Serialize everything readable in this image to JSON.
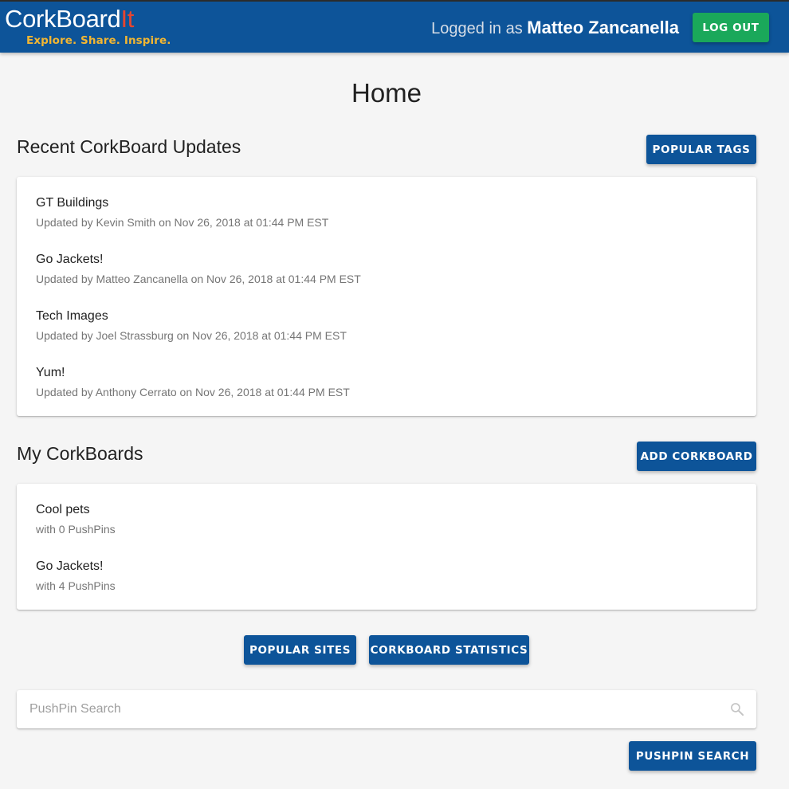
{
  "header": {
    "logo_main": "CorkBoard",
    "logo_accent": "It",
    "tagline": "Explore. Share. Inspire.",
    "login_prefix": "Logged in as",
    "user_name": "Matteo Zancanella",
    "logout_label": "LOG OUT"
  },
  "page_title": "Home",
  "recent": {
    "heading": "Recent CorkBoard Updates",
    "button_label": "POPULAR TAGS",
    "items": [
      {
        "title": "GT Buildings",
        "subtitle": "Updated by Kevin Smith on Nov 26, 2018 at 01:44 PM EST"
      },
      {
        "title": "Go Jackets!",
        "subtitle": "Updated by Matteo Zancanella on Nov 26, 2018 at 01:44 PM EST"
      },
      {
        "title": "Tech Images",
        "subtitle": "Updated by Joel Strassburg on Nov 26, 2018 at 01:44 PM EST"
      },
      {
        "title": "Yum!",
        "subtitle": "Updated by Anthony Cerrato on Nov 26, 2018 at 01:44 PM EST"
      }
    ]
  },
  "my_boards": {
    "heading": "My CorkBoards",
    "button_label": "ADD CORKBOARD",
    "items": [
      {
        "title": "Cool pets",
        "subtitle": "with 0 PushPins"
      },
      {
        "title": "Go Jackets!",
        "subtitle": "with 4 PushPins"
      }
    ]
  },
  "actions": {
    "popular_sites_label": "POPULAR SITES",
    "statistics_label": "CORKBOARD STATISTICS"
  },
  "search": {
    "placeholder": "PushPin Search",
    "value": "",
    "button_label": "PUSHPIN SEARCH"
  },
  "colors": {
    "primary": "#0d5499",
    "logout": "#1aa85a",
    "logo_accent": "#e8452f",
    "tagline": "#f2b632",
    "background": "#f5f5f5"
  }
}
